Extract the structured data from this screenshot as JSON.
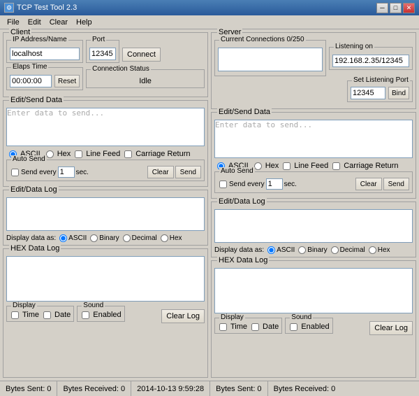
{
  "window": {
    "title": "TCP Test Tool 2.3"
  },
  "menu": {
    "items": [
      "File",
      "Edit",
      "Clear",
      "Help"
    ]
  },
  "client": {
    "label": "Client",
    "ip_label": "IP Address/Name",
    "ip_value": "localhost",
    "port_label": "Port",
    "port_value": "12345",
    "connect_btn": "Connect",
    "elaps_label": "Elaps Time",
    "elaps_value": "00:00:00",
    "reset_btn": "Reset",
    "conn_status_label": "Connection Status",
    "conn_status_value": "Idle",
    "edit_send_label": "Edit/Send Data",
    "edit_send_placeholder": "Enter data to send...",
    "ascii_label": "ASCII",
    "hex_label": "Hex",
    "line_feed_label": "Line Feed",
    "carriage_return_label": "Carriage Return",
    "auto_send_label": "Auto Send",
    "send_every_label": "Send every",
    "send_every_value": "1",
    "sec_label": "sec.",
    "clear_btn": "Clear",
    "send_btn": "Send",
    "data_log_label": "Edit/Data Log",
    "display_as_label": "Display data as:",
    "display_ascii": "ASCII",
    "display_binary": "Binary",
    "display_decimal": "Decimal",
    "display_hex": "Hex",
    "hex_log_label": "HEX Data Log",
    "display_label": "Display",
    "time_label": "Time",
    "date_label": "Date",
    "sound_label": "Sound",
    "enabled_label": "Enabled",
    "clear_log_btn": "Clear Log"
  },
  "server": {
    "label": "Server",
    "current_connections_label": "Current Connections 0/250",
    "listening_on_label": "Listening on",
    "listening_on_value": "192.168.2.35/12345",
    "set_listening_port_label": "Set Listening Port",
    "set_listening_port_value": "12345",
    "bind_btn": "Bind",
    "edit_send_label": "Edit/Send Data",
    "edit_send_placeholder": "Enter data to send...",
    "ascii_label": "ASCII",
    "hex_label": "Hex",
    "line_feed_label": "Line Feed",
    "carriage_return_label": "Carriage Return",
    "auto_send_label": "Auto Send",
    "send_every_label": "Send every",
    "send_every_value": "1",
    "sec_label": "sec.",
    "clear_btn": "Clear",
    "send_btn": "Send",
    "data_log_label": "Edit/Data Log",
    "display_as_label": "Display data as:",
    "display_ascii": "ASCII",
    "display_binary": "Binary",
    "display_decimal": "Decimal",
    "display_hex": "Hex",
    "hex_log_label": "HEX Data Log",
    "display_label": "Display",
    "time_label": "Time",
    "date_label": "Date",
    "sound_label": "Sound",
    "enabled_label": "Enabled",
    "clear_log_btn": "Clear Log"
  },
  "statusbar": {
    "bytes_sent_left": "Bytes Sent: 0",
    "bytes_received_left": "Bytes Received: 0",
    "timestamp": "2014-10-13 9:59:28",
    "bytes_sent_right": "Bytes Sent: 0",
    "bytes_received_right": "Bytes Received: 0"
  }
}
